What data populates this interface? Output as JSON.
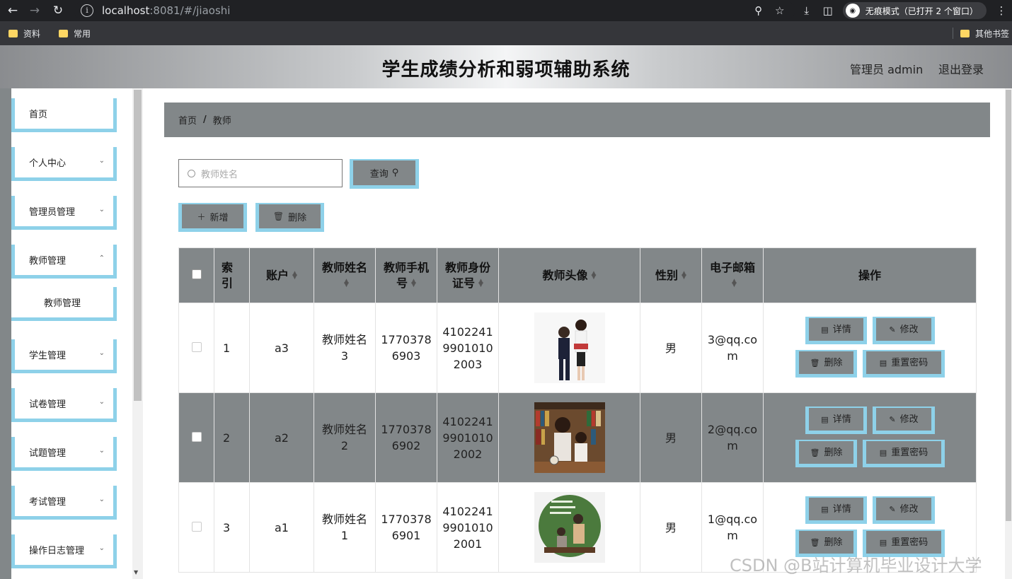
{
  "browser": {
    "url_host": "localhost",
    "url_rest": ":8081/#/jiaoshi",
    "incognito_label": "无痕模式（已打开 2 个窗口）",
    "bookmarks": [
      "资料",
      "常用"
    ],
    "other_bookmarks": "其他书签"
  },
  "app": {
    "title": "学生成绩分析和弱项辅助系统",
    "user": "管理员 admin",
    "logout": "退出登录"
  },
  "sidebar": {
    "items": [
      {
        "label": "首页"
      },
      {
        "label": "个人中心"
      },
      {
        "label": "管理员管理"
      },
      {
        "label": "教师管理"
      },
      {
        "label": "学生管理"
      },
      {
        "label": "试卷管理"
      },
      {
        "label": "试题管理"
      },
      {
        "label": "考试管理"
      },
      {
        "label": "操作日志管理"
      }
    ],
    "sub_item": "教师管理"
  },
  "breadcrumb": {
    "home": "首页",
    "sep": "/",
    "current": "教师"
  },
  "search": {
    "placeholder": "教师姓名",
    "button": "查询"
  },
  "actions": {
    "add": "新增",
    "delete": "删除"
  },
  "table": {
    "headers": [
      "索引",
      "账户",
      "教师姓名",
      "教师手机号",
      "教师身份证号",
      "教师头像",
      "性别",
      "电子邮箱",
      "操作"
    ],
    "rows": [
      {
        "index": "1",
        "account": "a3",
        "name": "教师姓名3",
        "phone": "17703786903",
        "idcard": "410224199010102003",
        "gender": "男",
        "email": "3@qq.com"
      },
      {
        "index": "2",
        "account": "a2",
        "name": "教师姓名2",
        "phone": "17703786902",
        "idcard": "410224199010102002",
        "gender": "男",
        "email": "2@qq.com"
      },
      {
        "index": "3",
        "account": "a1",
        "name": "教师姓名1",
        "phone": "17703786901",
        "idcard": "410224199010102001",
        "gender": "男",
        "email": "1@qq.com"
      }
    ],
    "row_actions": {
      "detail": "详情",
      "edit": "修改",
      "delete": "删除",
      "reset": "重置密码"
    }
  },
  "watermark": "CSDN @B站计算机毕业设计大学"
}
